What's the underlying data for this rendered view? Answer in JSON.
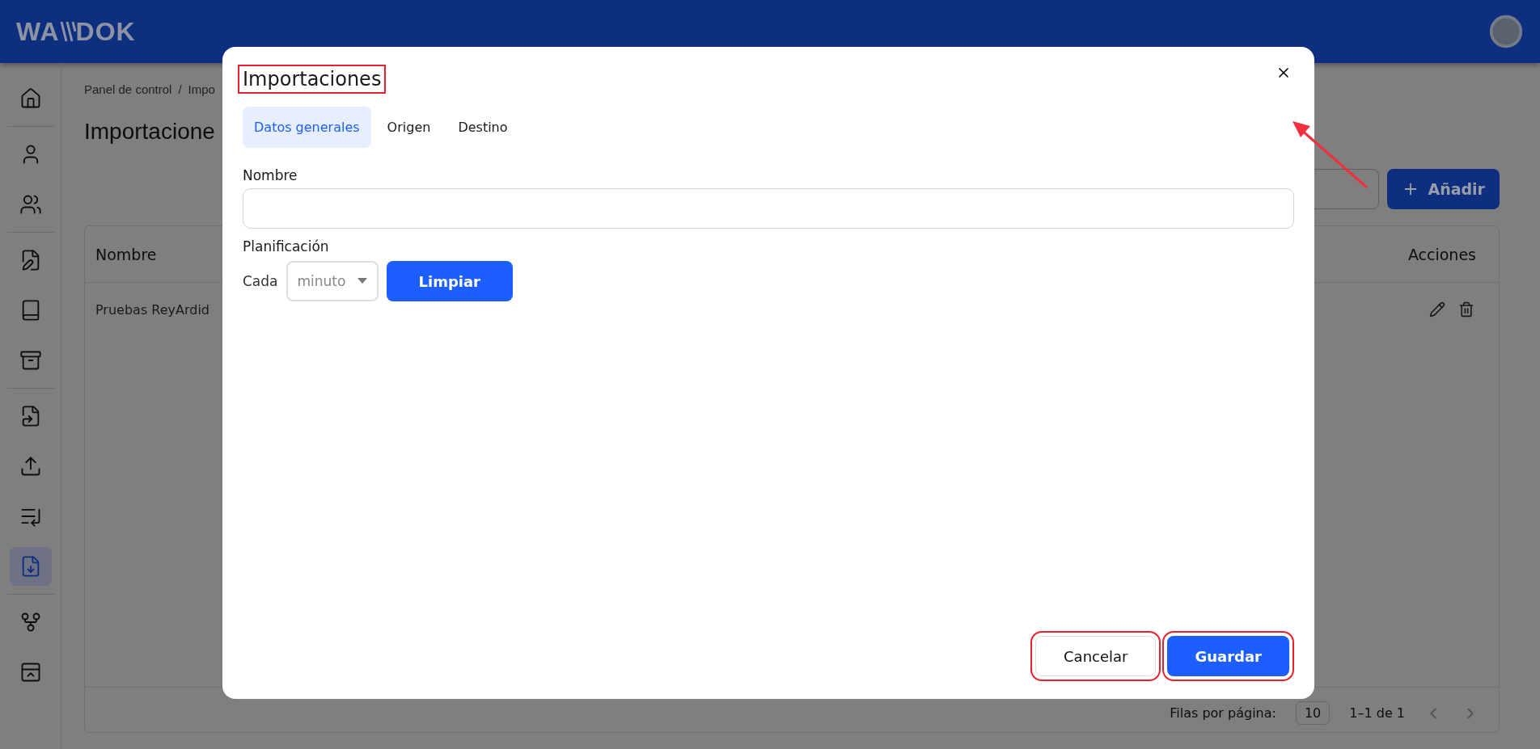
{
  "header": {
    "logo_left": "WA",
    "logo_right": "DOK"
  },
  "sidebar": {
    "groups": [
      {
        "items": [
          {
            "selected": false
          }
        ]
      },
      {
        "items": [
          {
            "selected": false
          },
          {
            "selected": false
          }
        ]
      },
      {
        "items": [
          {
            "selected": false
          },
          {
            "selected": false
          },
          {
            "selected": false
          }
        ]
      },
      {
        "items": [
          {
            "selected": false
          },
          {
            "selected": false
          },
          {
            "selected": false
          },
          {
            "selected": true
          }
        ]
      },
      {
        "items": [
          {
            "selected": false
          },
          {
            "selected": false
          }
        ]
      }
    ]
  },
  "breadcrumb": {
    "items": [
      "Panel de control",
      "Impo"
    ],
    "separator": "/"
  },
  "page_title": "Importacione",
  "add_button": "Añadir",
  "table": {
    "columns": [
      "Nombre",
      "Acciones"
    ],
    "rows": [
      {
        "name": "Pruebas ReyArdid"
      }
    ],
    "pagination": {
      "rows_per_page_label": "Filas por página:",
      "rows_per_page": "10",
      "range": "1–1 de 1"
    }
  },
  "dialog": {
    "title": "Importaciones",
    "title_highlighted": true,
    "tabs": [
      {
        "label": "Datos generales",
        "selected": true
      },
      {
        "label": "Origen",
        "selected": false
      },
      {
        "label": "Destino",
        "selected": false
      }
    ],
    "name_label": "Nombre",
    "planning_label": "Planificación",
    "every_label": "Cada",
    "unit_placeholder": "minuto",
    "clear_button": "Limpiar",
    "buttons": [
      {
        "label": "Cancelar",
        "kind": "secondary",
        "highlighted": true
      },
      {
        "label": "Guardar",
        "kind": "primary",
        "highlighted": true
      }
    ]
  }
}
